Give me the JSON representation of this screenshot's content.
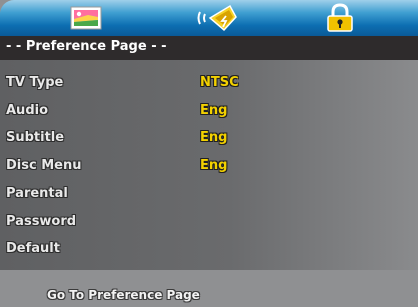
{
  "tabs": [
    {
      "icon": "video-picture-icon"
    },
    {
      "icon": "speaker-audio-icon"
    },
    {
      "icon": "padlock-icon"
    }
  ],
  "header": {
    "title": "- - Preference Page - -"
  },
  "settings": [
    {
      "label": "TV Type",
      "value": "NTSC"
    },
    {
      "label": "Audio",
      "value": "Eng"
    },
    {
      "label": "Subtitle",
      "value": "Eng"
    },
    {
      "label": "Disc Menu",
      "value": "Eng"
    },
    {
      "label": "Parental",
      "value": ""
    },
    {
      "label": "Password",
      "value": ""
    },
    {
      "label": "Default",
      "value": ""
    }
  ],
  "footer": {
    "hint": "Go To Preference Page"
  },
  "colors": {
    "header_bg": "#2e2b2c",
    "value_text": "#f3d100",
    "tabbar_blue": "#0d6fb2"
  }
}
